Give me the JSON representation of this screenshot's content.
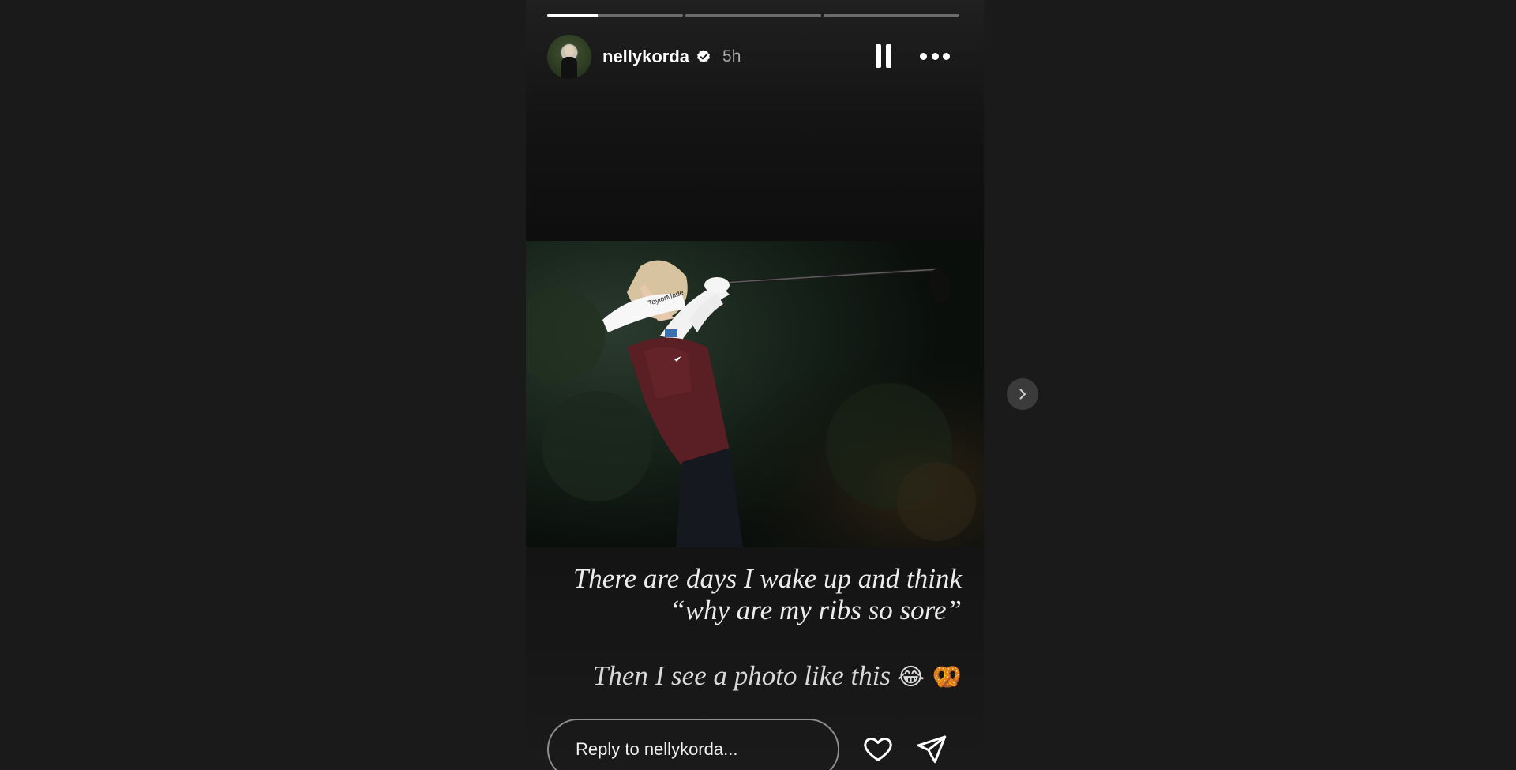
{
  "story": {
    "progress": [
      0.37,
      0,
      0
    ],
    "username": "nellykorda",
    "verified": true,
    "time_ago": "5h",
    "controls": {
      "pause_icon": "pause-icon",
      "more_icon": "more-icon"
    },
    "caption_line_1": "There are days I wake up and think",
    "caption_line_2": "“why are my ribs so sore”",
    "caption_line_3": "Then I see a photo like this",
    "caption_emojis": "😂 🥨"
  },
  "reply": {
    "placeholder": "Reply to nellykorda..."
  },
  "actions": {
    "like_icon": "heart-icon",
    "share_icon": "send-icon"
  },
  "navigation": {
    "next_icon": "chevron-right-icon"
  },
  "colors": {
    "background": "#1a1a1a",
    "text": "#ffffff",
    "muted_text": "#a8a8a8",
    "verified_badge": "#ffffff"
  }
}
